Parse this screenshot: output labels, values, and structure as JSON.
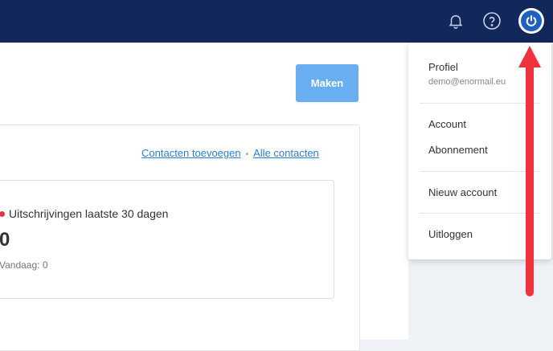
{
  "header": {
    "notifications_icon": "bell-icon",
    "help_icon": "question-icon",
    "account_icon": "power-icon"
  },
  "toolbar": {
    "create_label": "Maken"
  },
  "contacts": {
    "add_link": "Contacten toevoegen",
    "separator": "•",
    "all_link": "Alle contacten"
  },
  "stat": {
    "title": "Uitschrijvingen laatste 30 dagen",
    "value": "0",
    "today": "Vandaag: 0",
    "dot_color": "#e8303e"
  },
  "menu": {
    "profile_label": "Profiel",
    "email": "demo@enormail.eu",
    "account_label": "Account",
    "subscription_label": "Abonnement",
    "new_account_label": "Nieuw account",
    "logout_label": "Uitloggen"
  },
  "colors": {
    "topbar": "#13285a",
    "button": "#6aaef2",
    "link": "#2b7fd3",
    "arrow": "#f0323c"
  }
}
